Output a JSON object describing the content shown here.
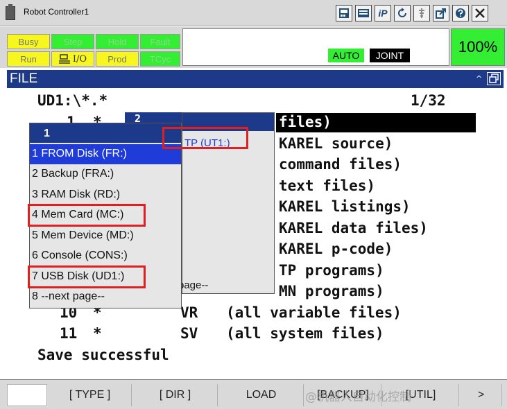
{
  "window": {
    "title": "Robot Controller1"
  },
  "toolbar": {
    "ip_label": "iP"
  },
  "status": {
    "busy": "Busy",
    "step": "Step",
    "hold": "Hold",
    "fault": "Fault",
    "run": "Run",
    "io": "I/O",
    "prod": "Prod",
    "tcyc": "TCyc",
    "mode": "AUTO",
    "coord": "JOINT",
    "override": "100%"
  },
  "screen": {
    "title": "FILE"
  },
  "content": {
    "path": "UD1:\\*.*",
    "page": "1/32",
    "rows": [
      {
        "num": "1",
        "mark": "*",
        "ext": "",
        "desc": "files)",
        "selected": true
      },
      {
        "num": "",
        "mark": "",
        "ext": "",
        "desc": "KAREL source)"
      },
      {
        "num": "",
        "mark": "",
        "ext": "",
        "desc": "command files)"
      },
      {
        "num": "",
        "mark": "",
        "ext": "",
        "desc": "text files)"
      },
      {
        "num": "",
        "mark": "",
        "ext": "",
        "desc": "KAREL listings)"
      },
      {
        "num": "",
        "mark": "",
        "ext": "",
        "desc": "KAREL data files)"
      },
      {
        "num": "",
        "mark": "",
        "ext": "",
        "desc": "KAREL p-code)"
      },
      {
        "num": "",
        "mark": "",
        "ext": "",
        "desc": "TP programs)"
      },
      {
        "num": "",
        "mark": "",
        "ext": "",
        "desc": "MN programs)"
      },
      {
        "num": "10",
        "mark": "*",
        "ext": "VR",
        "desc": "(all variable files)"
      },
      {
        "num": "11",
        "mark": "*",
        "ext": "SV",
        "desc": "(all system files)"
      }
    ],
    "message": "Save successful"
  },
  "device_menu": {
    "header": "1",
    "items": [
      "1 FROM Disk (FR:)",
      "2 Backup (FRA:)",
      "3 RAM Disk (RD:)",
      "4 Mem Card (MC:)",
      "5 Mem Device (MD:)",
      "6 Console (CONS:)",
      "7 USB Disk (UD1:)",
      "8 --next page--"
    ]
  },
  "submenu": {
    "header": "2",
    "item_1": "TP (UT1:)",
    "next": "page--"
  },
  "footer": {
    "keys": [
      "[ TYPE ]",
      "[ DIR ]",
      "LOAD",
      "[BACKUP]",
      "[UTIL]"
    ],
    "more": ">"
  },
  "watermark": "@机器人自动化控制"
}
